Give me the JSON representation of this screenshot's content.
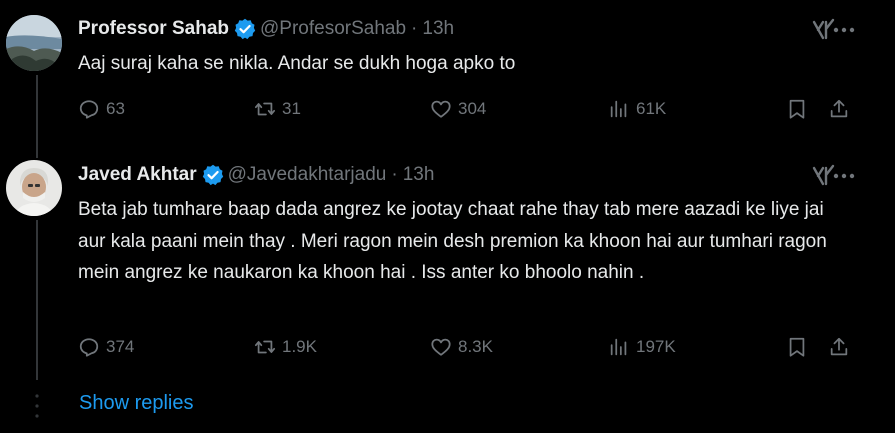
{
  "tweets": [
    {
      "name": "Professor Sahab",
      "handle": "@ProfesorSahab",
      "separator": "·",
      "time": "13h",
      "text": "Aaj suraj kaha se nikla. Andar se dukh hoga apko to",
      "replies": "63",
      "retweets": "31",
      "likes": "304",
      "views": "61K"
    },
    {
      "name": "Javed Akhtar",
      "handle": "@Javedakhtarjadu",
      "separator": "·",
      "time": "13h",
      "text": "Beta jab tumhare baap dada angrez ke jootay chaat rahe thay tab mere aazadi ke liye jai aur kala paani mein thay . Meri ragon mein desh premion ka khoon hai aur tumhari ragon mein angrez ke naukaron ka khoon hai .  Iss anter ko bhoolo nahin .",
      "replies": "374",
      "retweets": "1.9K",
      "likes": "8.3K",
      "views": "197K"
    }
  ],
  "show_replies": "Show replies",
  "colors": {
    "background": "#000000",
    "text": "#e7e9ea",
    "muted": "#71767b",
    "accent": "#1d9bf0",
    "divider": "#333639"
  },
  "icons": [
    "verified-badge-icon",
    "grok-icon",
    "more-icon",
    "reply-icon",
    "retweet-icon",
    "like-icon",
    "views-icon",
    "bookmark-icon",
    "share-icon"
  ]
}
